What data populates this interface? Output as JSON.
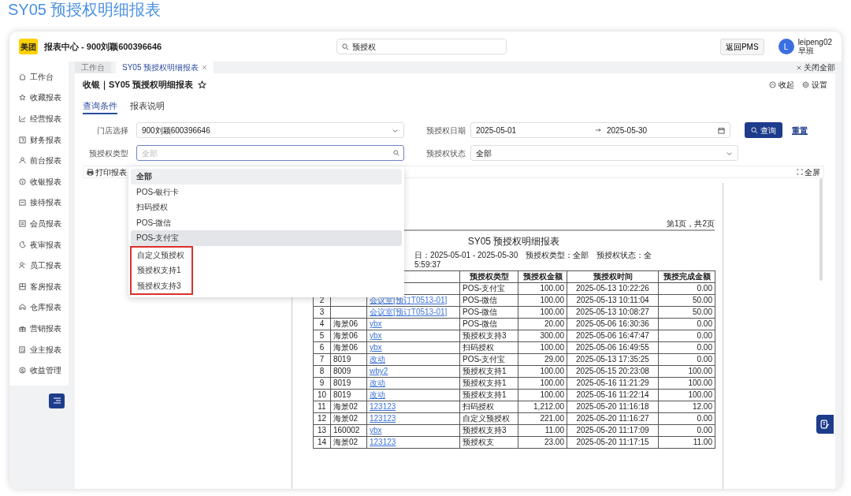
{
  "page_title": "SY05 预授权明细报表",
  "header": {
    "logo": "美团",
    "title": "报表中心 - 900刘颖600396646",
    "search": {
      "value": "预授权"
    },
    "back_button": "返回PMS",
    "avatar": "L",
    "user": "leipeng02",
    "shift": "早班"
  },
  "sidebar": {
    "items": [
      {
        "label": "工作台"
      },
      {
        "label": "收藏报表"
      },
      {
        "label": "经营报表"
      },
      {
        "label": "财务报表"
      },
      {
        "label": "前台报表"
      },
      {
        "label": "收银报表"
      },
      {
        "label": "接待报表"
      },
      {
        "label": "会员报表"
      },
      {
        "label": "夜审报表"
      },
      {
        "label": "员工报表"
      },
      {
        "label": "客房报表"
      },
      {
        "label": "仓库报表"
      },
      {
        "label": "营销报表"
      },
      {
        "label": "业主报表"
      },
      {
        "label": "收益管理"
      }
    ]
  },
  "tabs": [
    {
      "label": "工作台",
      "selected": false,
      "closable": false
    },
    {
      "label": "SY05 预授权明细报表",
      "selected": true,
      "closable": true
    }
  ],
  "close_all": "关闭全部",
  "report": {
    "breadcrumb": "收银｜SY05 预授权明细报表",
    "favorite": false,
    "collapse": "收起",
    "settings": "设置",
    "query_tabs": [
      {
        "label": "查询条件",
        "selected": true
      },
      {
        "label": "报表说明",
        "selected": false
      }
    ],
    "filters": {
      "store": {
        "label": "门店选择",
        "value": "900刘颖600396646"
      },
      "date": {
        "label": "预授权日期",
        "start": "2025-05-01",
        "end": "2025-05-30"
      },
      "type": {
        "label": "预授权类型",
        "placeholder": "全部",
        "focused": true
      },
      "status": {
        "label": "预授权状态",
        "value": "全部"
      }
    },
    "query_button": "查询",
    "reset_link": "重置",
    "toolbar": {
      "print": "打印报表",
      "fullscreen": "全屏"
    },
    "dropdown": {
      "options": [
        {
          "label": "全部",
          "selected": true,
          "hovered": false,
          "annotated": false
        },
        {
          "label": "POS-银行卡",
          "selected": false,
          "hovered": false,
          "annotated": false
        },
        {
          "label": "扫码授权",
          "selected": false,
          "hovered": false,
          "annotated": false
        },
        {
          "label": "POS-微信",
          "selected": false,
          "hovered": false,
          "annotated": false
        },
        {
          "label": "POS-支付宝",
          "selected": false,
          "hovered": true,
          "annotated": false
        },
        {
          "label": "自定义预授权",
          "selected": false,
          "hovered": false,
          "annotated": true
        },
        {
          "label": "预授权支持1",
          "selected": false,
          "hovered": false,
          "annotated": true
        },
        {
          "label": "预授权支持3",
          "selected": false,
          "hovered": false,
          "annotated": true
        }
      ]
    },
    "document": {
      "page_info": "第1页，共2页",
      "title": "SY05 预授权明细报表",
      "meta": [
        "日：2025-05-01 - 2025-05-30",
        "预授权类型：全部",
        "预授权状态：全"
      ],
      "meta_line2": "5:59:37",
      "columns": {
        "type": "预授权类型",
        "amount": "预授权金额",
        "time": "预授权时间",
        "completed": "预授完成金额"
      },
      "rows": [
        {
          "type": "POS-支付宝",
          "amount": "100.00",
          "time": "2025-05-13 10:22:26",
          "completed": "0.00"
        },
        {
          "no": "2",
          "column_3": "会议室[预订T0513-01]",
          "type": "POS-微信",
          "amount": "100.00",
          "time": "2025-05-13 10:11:04",
          "completed": "50.00"
        },
        {
          "no": "3",
          "column_3": "会议室[预订T0513-01]",
          "type": "POS-微信",
          "amount": "100.00",
          "time": "2025-05-13 10:08:27",
          "completed": "50.00"
        },
        {
          "no": "4",
          "column_2": "海景06",
          "column_3": "ybx",
          "type": "POS-微信",
          "amount": "20.00",
          "time": "2025-05-06 16:30:36",
          "completed": "0.00"
        },
        {
          "no": "5",
          "column_2": "海景06",
          "column_3": "ybx",
          "type": "预授权支持3",
          "amount": "300.00",
          "time": "2025-05-06 16:47:47",
          "completed": "0.00"
        },
        {
          "no": "6",
          "column_2": "海景06",
          "column_3": "ybx",
          "type": "扫码授权",
          "amount": "100.00",
          "time": "2025-05-06 16:49:55",
          "completed": "0.00"
        },
        {
          "no": "7",
          "column_2": "8019",
          "column_3": "改动",
          "type": "POS-支付宝",
          "amount": "29.00",
          "time": "2025-05-13 17:35:25",
          "completed": "0.00"
        },
        {
          "no": "8",
          "column_2": "8009",
          "column_3": "wby2",
          "type": "预授权支持1",
          "amount": "100.00",
          "time": "2025-05-15 20:23:08",
          "completed": "100.00"
        },
        {
          "no": "9",
          "column_2": "8019",
          "column_3": "改动",
          "type": "预授权支持1",
          "amount": "100.00",
          "time": "2025-05-16 11:21:29",
          "completed": "100.00"
        },
        {
          "no": "10",
          "column_2": "8019",
          "column_3": "改动",
          "type": "预授权支持1",
          "amount": "100.00",
          "time": "2025-05-16 11:22:14",
          "completed": "100.00"
        },
        {
          "no": "11",
          "column_2": "海景02",
          "column_3": "123123",
          "type": "扫码授权",
          "amount": "1,212.00",
          "time": "2025-05-20 11:16:18",
          "completed": "12.00"
        },
        {
          "no": "12",
          "column_2": "海景02",
          "column_3": "123123",
          "type": "自定义预授权",
          "amount": "221.00",
          "time": "2025-05-20 11:16:27",
          "completed": "0.00"
        },
        {
          "no": "13",
          "column_2": "160002",
          "column_3": "ybx",
          "type": "预授权支持3",
          "amount": "11.00",
          "time": "2025-05-20 11:17:09",
          "completed": "0.00"
        },
        {
          "no": "14",
          "column_2": "海景02",
          "column_3": "123123",
          "type": "预授权支",
          "amount": "23.00",
          "time": "2025-05-20 11:17:15",
          "completed": "11.00"
        }
      ]
    }
  }
}
